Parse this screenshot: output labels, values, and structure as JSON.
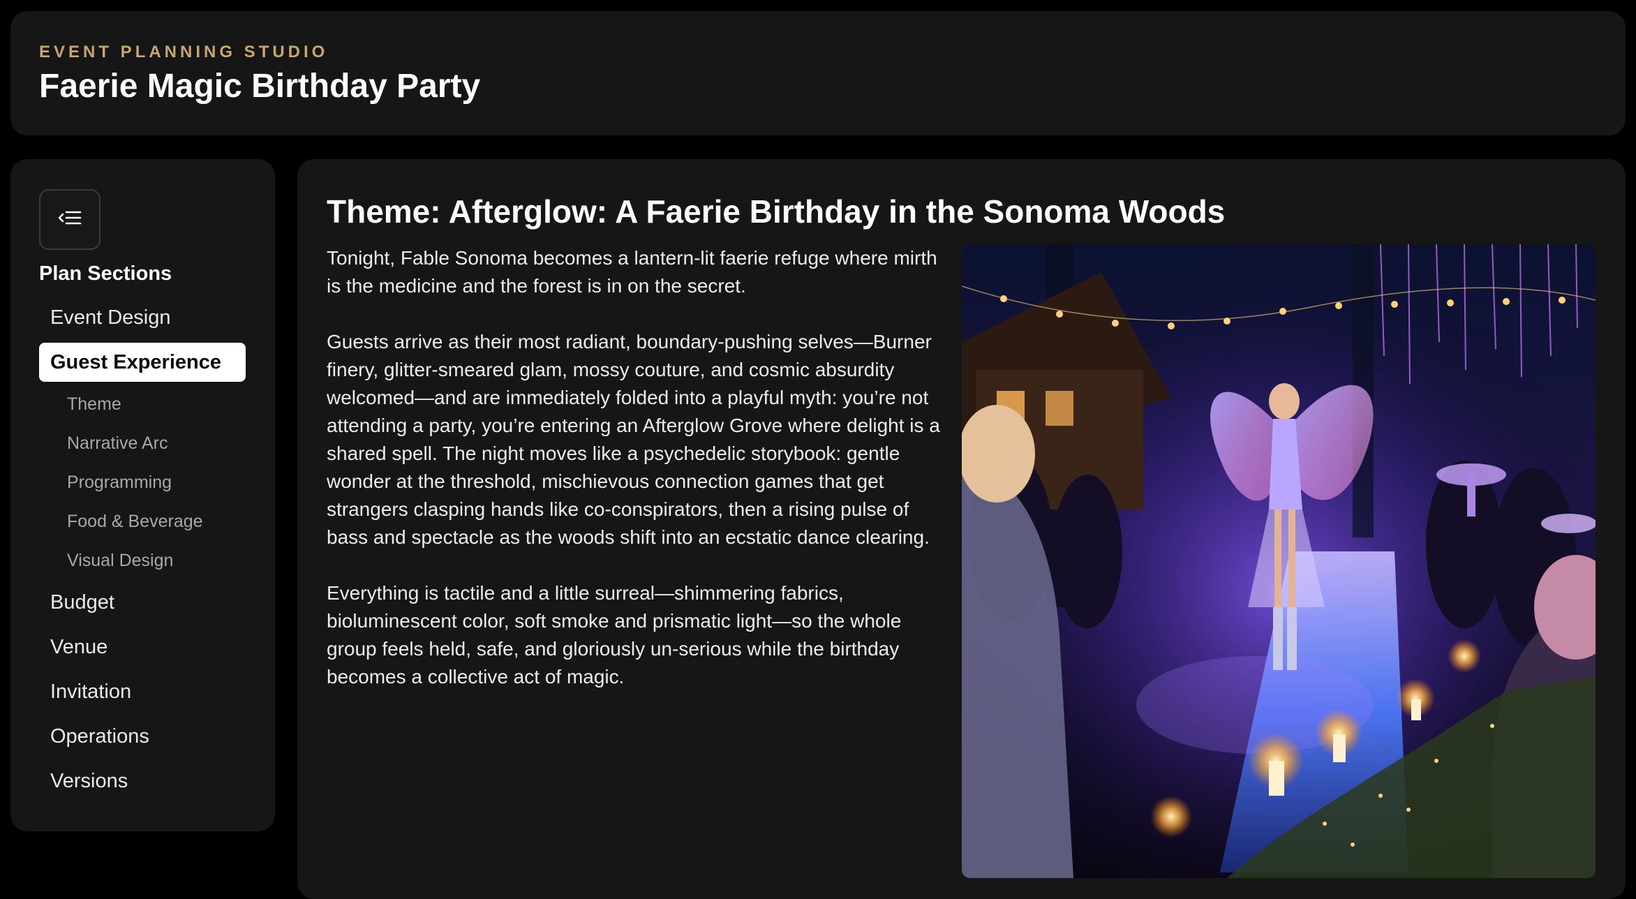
{
  "header": {
    "eyebrow": "EVENT PLANNING STUDIO",
    "title": "Faerie Magic Birthday Party"
  },
  "sidebar": {
    "collapse_icon": "collapse-menu-icon",
    "heading": "Plan Sections",
    "items": [
      {
        "label": "Event Design"
      },
      {
        "label": "Guest Experience",
        "active": true
      },
      {
        "label": "Budget"
      },
      {
        "label": "Venue"
      },
      {
        "label": "Invitation"
      },
      {
        "label": "Operations"
      },
      {
        "label": "Versions"
      }
    ],
    "subitems": [
      {
        "label": "Theme"
      },
      {
        "label": "Narrative Arc"
      },
      {
        "label": "Programming"
      },
      {
        "label": "Food & Beverage"
      },
      {
        "label": "Visual Design"
      }
    ]
  },
  "main": {
    "title": "Theme: Afterglow: A Faerie Birthday in the Sonoma Woods",
    "paragraphs": [
      "Tonight, Fable Sonoma becomes a lantern-lit faerie refuge where mirth is the medicine and the forest is in on the secret.",
      "Guests arrive as their most radiant, boundary-pushing selves—Burner finery, glitter-smeared glam, mossy couture, and cosmic absurdity welcomed—and are immediately folded into a playful myth: you’re not attending a party, you’re entering an Afterglow Grove where delight is a shared spell. The night moves like a psychedelic storybook: gentle wonder at the threshold, mischievous connection games that get strangers clasping hands like co-conspirators, then a rising pulse of bass and spectacle as the woods shift into an ecstatic dance clearing.",
      "Everything is tactile and a little surreal—shimmering fabrics, bioluminescent color, soft smoke and prismatic light—so the whole group feels held, safe, and gloriously un-serious while the birthday becomes a collective act of magic."
    ]
  },
  "colors": {
    "background": "#000000",
    "panel": "#161616",
    "accent": "#c9a66b",
    "active_bg": "#ffffff"
  }
}
